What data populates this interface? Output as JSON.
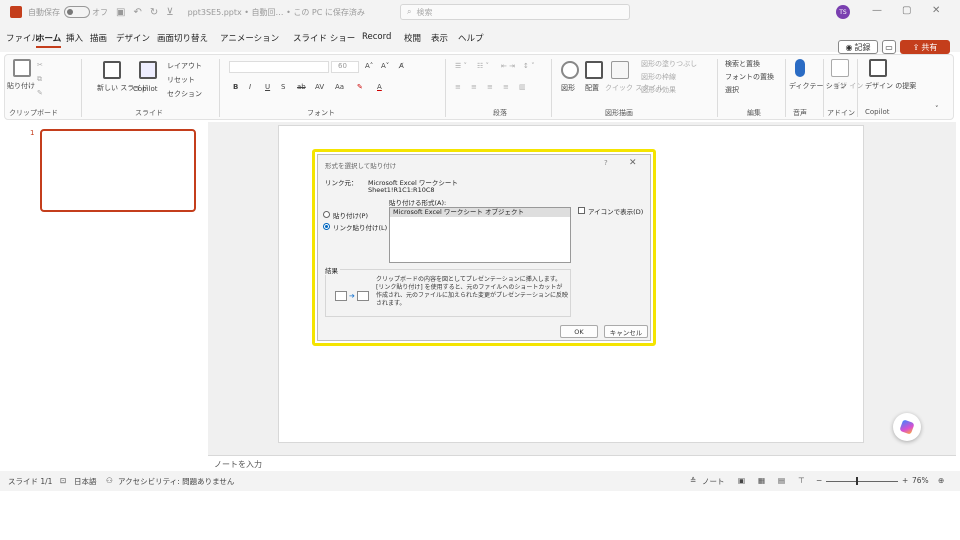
{
  "titlebar": {
    "autosave_label": "自動保存",
    "autosave_state": "オフ",
    "doc_title": "ppt3SE5.pptx • 自動回… • この PC に保存済み",
    "search_placeholder": "検索",
    "avatar_initials": "TS",
    "minimize": "—",
    "restore": "▢",
    "close": "✕"
  },
  "menu": {
    "tabs": [
      "ファイル",
      "ホーム",
      "挿入",
      "描画",
      "デザイン",
      "画面切り替え",
      "アニメーション",
      "スライド ショー",
      "Record",
      "校閲",
      "表示",
      "ヘルプ"
    ],
    "active_index": 1,
    "record_label": "記録",
    "share_label": "共有"
  },
  "ribbon": {
    "clipboard": {
      "paste": "貼り付け",
      "group": "クリップボード"
    },
    "slides": {
      "new_slide": "新しい\nスライド",
      "copilot": "Copilot",
      "layout": "レイアウト",
      "reset": "リセット",
      "section": "セクション",
      "group": "スライド"
    },
    "font": {
      "size": "60",
      "bold": "B",
      "italic": "I",
      "underline": "U",
      "strike": "S",
      "group": "フォント"
    },
    "paragraph": {
      "group": "段落"
    },
    "drawing": {
      "shape": "図形",
      "arrange": "配置",
      "quick_style": "クイック\nスタイル",
      "fill": "図形の塗りつぶし",
      "outline": "図形の枠線",
      "effect": "図形の効果",
      "group": "図形描画"
    },
    "editing": {
      "find_replace": "検索と置換",
      "font_replace": "フォントの置換",
      "select": "選択",
      "group": "編集"
    },
    "voice": {
      "dictate": "ディクテー\nション",
      "group": "音声"
    },
    "designer": {
      "designer": "デザ\nイン",
      "group": "アドイン"
    },
    "copilot": {
      "label": "デザイン\nの提案",
      "group": "Copilot"
    }
  },
  "thumbnails": {
    "slide_number": "1"
  },
  "dialog": {
    "title": "形式を選択して貼り付け",
    "help": "?",
    "close": "✕",
    "source_label": "リンク元：",
    "source_value1": "Microsoft Excel ワークシート",
    "source_value2": "Sheet1!R1C1:R10C8",
    "format_label": "貼り付ける形式(A):",
    "options": [
      "貼り付け(P)",
      "リンク貼り付け(L)"
    ],
    "selected_option": 1,
    "formats": [
      "Microsoft Excel ワークシート オブジェクト"
    ],
    "icon_checkbox": "アイコンで表示(D)",
    "result_label": "結果",
    "result_text": "クリップボードの内容を図としてプレゼンテーションに挿入します。[リンク貼り付け] を使用すると、元のファイルへのショートカットが作成され、元のファイルに加えられた変更がプレゼンテーションに反映されます。",
    "ok": "OK",
    "cancel": "キャンセル"
  },
  "notes": {
    "placeholder": "ノートを入力"
  },
  "statusbar": {
    "slide_info": "スライド 1/1",
    "language": "日本語",
    "accessibility": "アクセシビリティ: 問題ありません",
    "notes_button": "ノート",
    "zoom": "76%"
  }
}
